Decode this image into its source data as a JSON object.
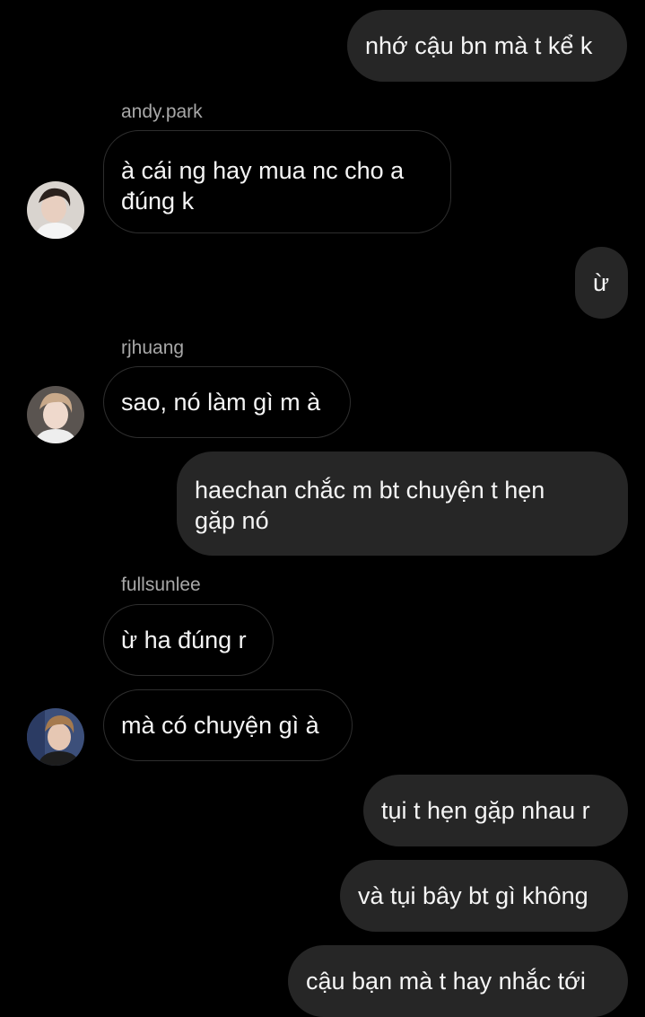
{
  "conversation": {
    "messages": [
      {
        "direction": "outgoing",
        "text": "nhớ cậu bn mà t kể k"
      },
      {
        "direction": "incoming",
        "sender": "andy.park",
        "text": "à cái ng hay mua nc cho a\nđúng k",
        "avatar": "profile-photo-boy-white-shirt"
      },
      {
        "direction": "outgoing",
        "text": "ừ"
      },
      {
        "direction": "incoming",
        "sender": "rjhuang",
        "text": "sao, nó làm gì m à",
        "avatar": "profile-photo-boy-light-hair"
      },
      {
        "direction": "outgoing",
        "text": "haechan chắc m bt chuyện t hẹn\ngặp nó"
      },
      {
        "direction": "incoming",
        "sender": "fullsunlee",
        "text": "ừ ha đúng r"
      },
      {
        "direction": "incoming",
        "text": "mà có chuyện gì à",
        "avatar": "profile-photo-boy-brown-hair"
      },
      {
        "direction": "outgoing",
        "text": "tụi t hẹn gặp nhau r"
      },
      {
        "direction": "outgoing",
        "text": "và tụi bây bt gì không"
      },
      {
        "direction": "outgoing",
        "text": "cậu bạn mà t hay nhắc tới"
      }
    ]
  },
  "theme": {
    "background": "#000000",
    "outgoing_bubble": "#262626",
    "incoming_border": "#2e2e2e",
    "sender_color": "#a8a8a8"
  }
}
